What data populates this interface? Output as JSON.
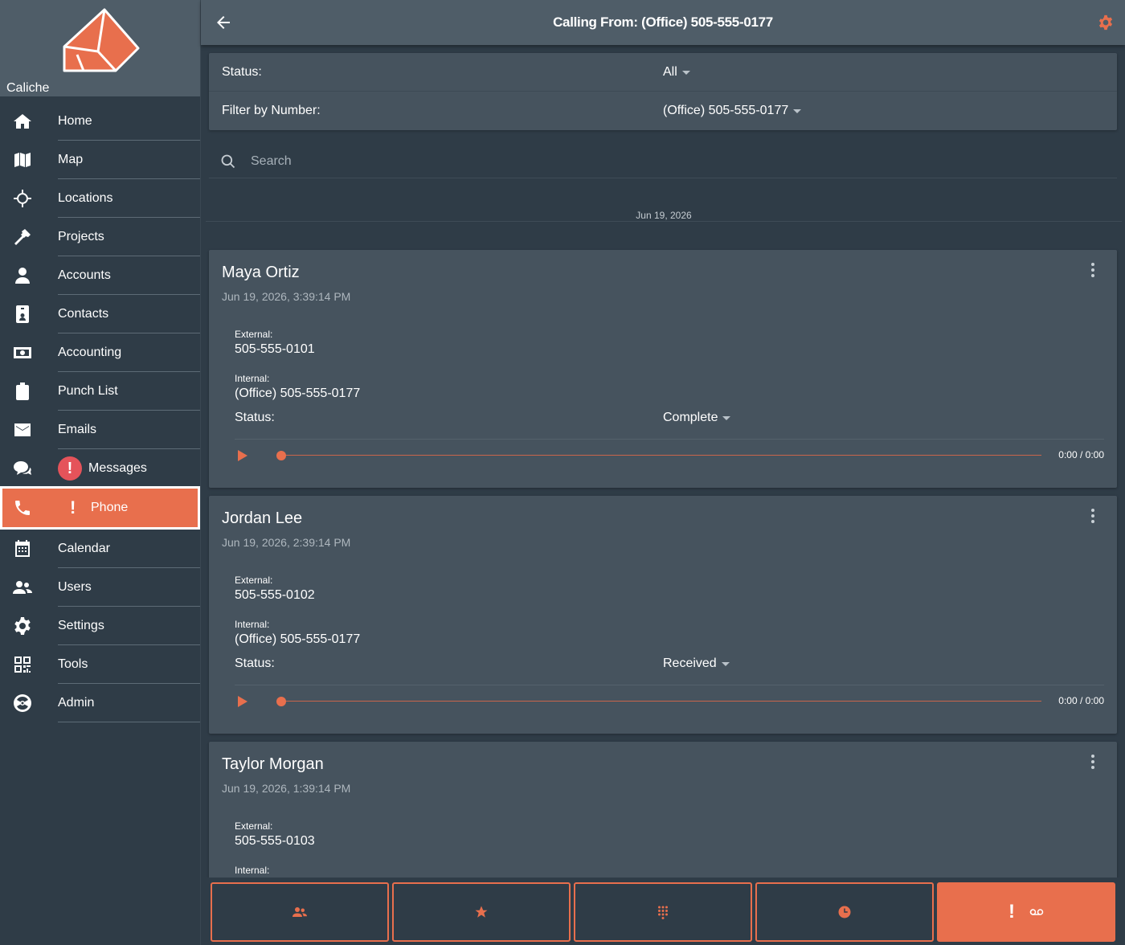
{
  "brand": {
    "name": "Caliche"
  },
  "header": {
    "title": "Calling From: (Office) 505-555-0177"
  },
  "sidebar": {
    "items": [
      {
        "label": "Home"
      },
      {
        "label": "Map"
      },
      {
        "label": "Locations"
      },
      {
        "label": "Projects"
      },
      {
        "label": "Accounts"
      },
      {
        "label": "Contacts"
      },
      {
        "label": "Accounting"
      },
      {
        "label": "Punch List"
      },
      {
        "label": "Emails"
      },
      {
        "label": "Messages",
        "alert": "!"
      },
      {
        "label": "Phone",
        "alert": "!"
      },
      {
        "label": "Calendar"
      },
      {
        "label": "Users"
      },
      {
        "label": "Settings"
      },
      {
        "label": "Tools"
      },
      {
        "label": "Admin"
      }
    ]
  },
  "filters": {
    "status_label": "Status:",
    "status_value": "All",
    "number_label": "Filter by Number:",
    "number_value": "(Office) 505-555-0177"
  },
  "search": {
    "placeholder": "Search"
  },
  "date_group": "Jun 19, 2026",
  "calls": [
    {
      "name": "Maya Ortiz",
      "datetime": "Jun 19, 2026, 3:39:14 PM",
      "external_label": "External:",
      "external": "505-555-0101",
      "internal_label": "Internal:",
      "internal": "(Office) 505-555-0177",
      "status_label": "Status:",
      "status": "Complete",
      "time": "0:00 / 0:00"
    },
    {
      "name": "Jordan Lee",
      "datetime": "Jun 19, 2026, 2:39:14 PM",
      "external_label": "External:",
      "external": "505-555-0102",
      "internal_label": "Internal:",
      "internal": "(Office) 505-555-0177",
      "status_label": "Status:",
      "status": "Received",
      "time": "0:00 / 0:00"
    },
    {
      "name": "Taylor Morgan",
      "datetime": "Jun 19, 2026, 1:39:14 PM",
      "external_label": "External:",
      "external": "505-555-0103",
      "internal_label": "Internal:"
    }
  ],
  "bottom_tabs": {
    "icons": [
      "people-icon",
      "star-icon",
      "dialpad-icon",
      "clock-icon",
      "voicemail-icon"
    ],
    "voicemail_alert": "!"
  },
  "colors": {
    "accent": "#e86f4d",
    "header": "#4f5d68",
    "background": "#2f3c47",
    "card": "#46535e",
    "alert": "#e5535a"
  }
}
